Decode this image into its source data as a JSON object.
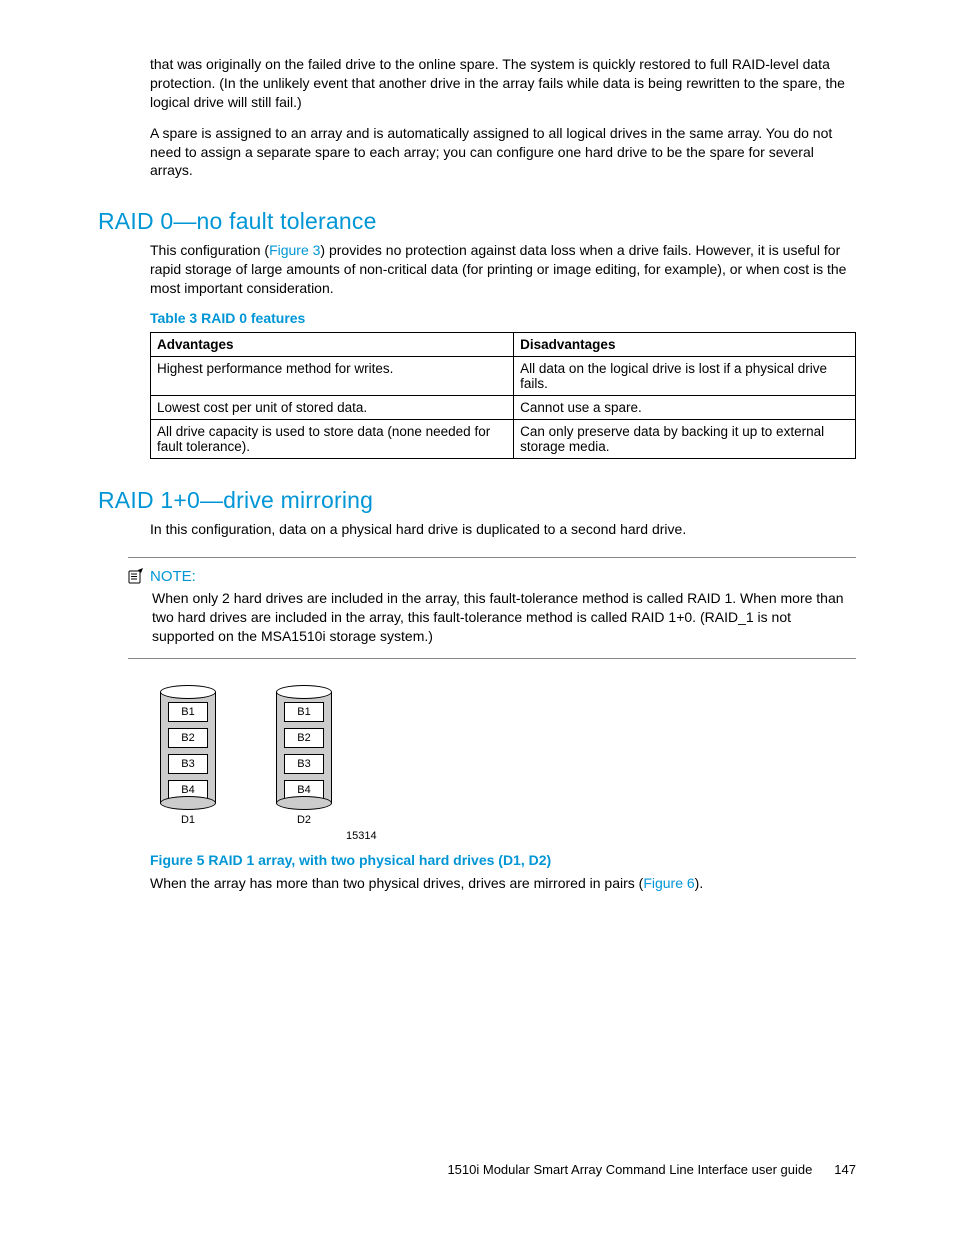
{
  "intro": {
    "p1": "that was originally on the failed drive to the online spare. The system is quickly restored to full RAID-level data protection. (In the unlikely event that another drive in the array fails while data is being rewritten to the spare, the logical drive will still fail.)",
    "p2": "A spare is assigned to an array and is automatically assigned to all logical drives in the same array. You do not need to assign a separate spare to each array; you can configure one hard drive to be the spare for several arrays."
  },
  "raid0": {
    "heading": "RAID 0—no fault tolerance",
    "desc_pre": "This configuration (",
    "desc_link": "Figure 3",
    "desc_post": ") provides no protection against data loss when a drive fails. However, it is useful for rapid storage of large amounts of non-critical data (for printing or image editing, for example), or when cost is the most important consideration.",
    "table_caption": "Table 3 RAID 0 features",
    "th_adv": "Advantages",
    "th_dis": "Disadvantages",
    "rows": [
      {
        "adv": "Highest performance method for writes.",
        "dis": "All data on the logical drive is lost if a physical drive fails."
      },
      {
        "adv": "Lowest cost per unit of stored data.",
        "dis": "Cannot use a spare."
      },
      {
        "adv": "All drive capacity is used to store data (none needed for fault tolerance).",
        "dis": "Can only preserve data by backing it up to external storage media."
      }
    ]
  },
  "raid10": {
    "heading": "RAID 1+0—drive mirroring",
    "desc": "In this configuration, data on a physical hard drive is duplicated to a second hard drive.",
    "note_label": "NOTE:",
    "note_body": "When only 2 hard drives are included in the array, this fault-tolerance method is called RAID 1. When more than two hard drives are included in the array, this fault-tolerance method is called RAID 1+0. (RAID_1 is not supported on the MSA1510i storage system.)",
    "figure": {
      "blocks": [
        "B1",
        "B2",
        "B3",
        "B4"
      ],
      "d1": "D1",
      "d2": "D2",
      "fignum": "15314",
      "caption": "Figure 5 RAID 1 array, with two physical hard drives (D1, D2)"
    },
    "after_pre": "When the array has more than two physical drives, drives are mirrored in pairs (",
    "after_link": "Figure 6",
    "after_post": ")."
  },
  "footer": {
    "title": "1510i Modular Smart Array Command Line Interface user guide",
    "page": "147"
  }
}
